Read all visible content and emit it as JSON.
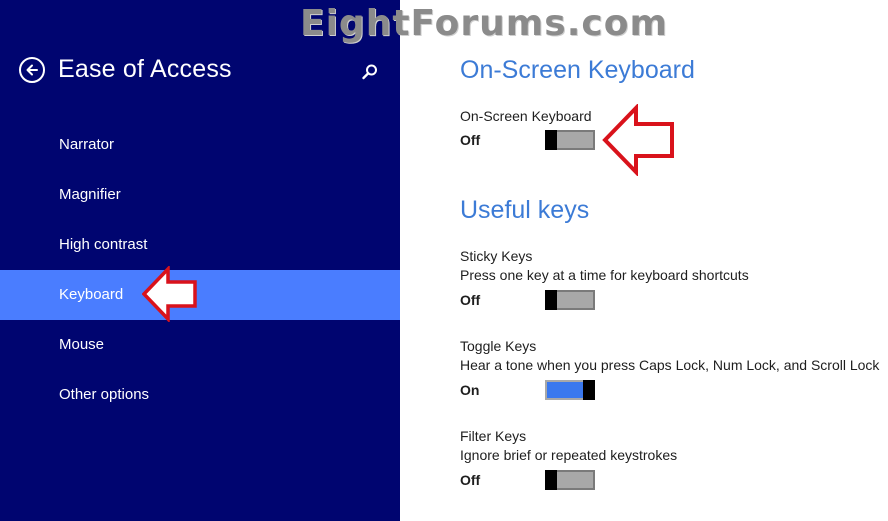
{
  "watermark": "EightForums.com",
  "sidebar": {
    "title": "Ease of Access",
    "items": [
      {
        "label": "Narrator",
        "active": false
      },
      {
        "label": "Magnifier",
        "active": false
      },
      {
        "label": "High contrast",
        "active": false
      },
      {
        "label": "Keyboard",
        "active": true
      },
      {
        "label": "Mouse",
        "active": false
      },
      {
        "label": "Other options",
        "active": false
      }
    ]
  },
  "main": {
    "osk_section": {
      "title": "On-Screen Keyboard",
      "setting": {
        "label": "On-Screen Keyboard",
        "state": "Off",
        "on": false
      }
    },
    "useful_keys_section": {
      "title": "Useful keys",
      "settings": [
        {
          "label": "Sticky Keys",
          "desc": "Press one key at a time for keyboard shortcuts",
          "state": "Off",
          "on": false
        },
        {
          "label": "Toggle Keys",
          "desc": "Hear a tone when you press Caps Lock, Num Lock, and Scroll Lock",
          "state": "On",
          "on": true
        },
        {
          "label": "Filter Keys",
          "desc": "Ignore brief or repeated keystrokes",
          "state": "Off",
          "on": false
        }
      ]
    }
  },
  "colors": {
    "sidebar_bg": "#000570",
    "active_item": "#4a7dff",
    "accent_title": "#3c7bd6",
    "toggle_on": "#3a78ee",
    "toggle_off": "#a8a8a8",
    "annotation_red": "#d9121b"
  },
  "icons": {
    "back": "back-arrow-circle-icon",
    "search": "search-icon",
    "annotation": "red-outline-arrow-icon"
  }
}
